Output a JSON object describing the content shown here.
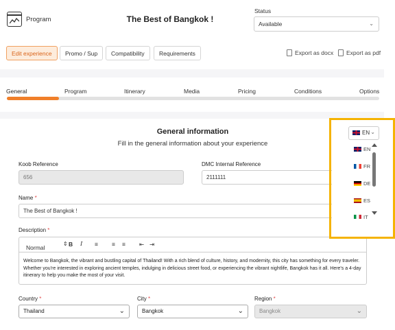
{
  "header": {
    "program_label": "Program",
    "title": "The Best of Bangkok !",
    "status_label": "Status",
    "status_value": "Available"
  },
  "actions": {
    "edit_experience": "Edit experience",
    "promo": "Promo / Sup",
    "compatibility": "Compatibility",
    "requirements": "Requirements",
    "export_docx": "Export as docx",
    "export_pdf": "Export as pdf"
  },
  "tabs": [
    "General",
    "Program",
    "Itinerary",
    "Media",
    "Pricing",
    "Conditions",
    "Options"
  ],
  "tab_progress": 0.14,
  "general": {
    "title": "General information",
    "subtitle": "Fill in the general information about your experience"
  },
  "language": {
    "current": "EN",
    "options": [
      {
        "code": "EN",
        "flag": "gb-flag-icon"
      },
      {
        "code": "FR",
        "flag": "fr-flag-icon"
      },
      {
        "code": "DE",
        "flag": "de-flag-icon"
      },
      {
        "code": "ES",
        "flag": "es-flag-icon"
      },
      {
        "code": "IT",
        "flag": "it-flag-icon"
      }
    ]
  },
  "form": {
    "koob_label": "Koob Reference",
    "koob_value": "656",
    "dmc_label": "DMC Internal Reference",
    "dmc_value": "2111111",
    "name_label": "Name",
    "name_value": "The Best of Bangkok !",
    "description_label": "Description",
    "format_select": "Normal",
    "description_text": "Welcome to Bangkok, the vibrant and bustling capital of Thailand! With a rich blend of culture, history, and modernity, this city has something for every traveler. Whether you're interested in exploring ancient temples, indulging in delicious street food, or experiencing the vibrant nightlife, Bangkok has it all. Here's a 4-day itinerary to help you make the most of your visit.",
    "country_label": "Country",
    "country_value": "Thailand",
    "city_label": "City",
    "city_value": "Bangkok",
    "region_label": "Region",
    "region_value": "Bangkok",
    "required_mark": "*"
  },
  "colors": {
    "accent": "#f07f2a",
    "highlight": "#f5b301",
    "required": "#e14a4a"
  }
}
